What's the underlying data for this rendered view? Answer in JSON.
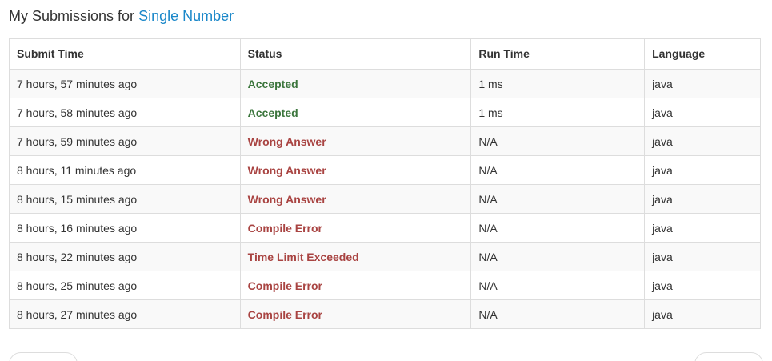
{
  "header": {
    "prefix": "My Submissions for",
    "problem_name": "Single Number"
  },
  "table": {
    "columns": [
      "Submit Time",
      "Status",
      "Run Time",
      "Language"
    ],
    "rows": [
      {
        "time": "7 hours, 57 minutes ago",
        "status": "Accepted",
        "status_type": "ok",
        "runtime": "1 ms",
        "language": "java"
      },
      {
        "time": "7 hours, 58 minutes ago",
        "status": "Accepted",
        "status_type": "ok",
        "runtime": "1 ms",
        "language": "java"
      },
      {
        "time": "7 hours, 59 minutes ago",
        "status": "Wrong Answer",
        "status_type": "bad",
        "runtime": "N/A",
        "language": "java"
      },
      {
        "time": "8 hours, 11 minutes ago",
        "status": "Wrong Answer",
        "status_type": "bad",
        "runtime": "N/A",
        "language": "java"
      },
      {
        "time": "8 hours, 15 minutes ago",
        "status": "Wrong Answer",
        "status_type": "bad",
        "runtime": "N/A",
        "language": "java"
      },
      {
        "time": "8 hours, 16 minutes ago",
        "status": "Compile Error",
        "status_type": "bad",
        "runtime": "N/A",
        "language": "java"
      },
      {
        "time": "8 hours, 22 minutes ago",
        "status": "Time Limit Exceeded",
        "status_type": "bad",
        "runtime": "N/A",
        "language": "java"
      },
      {
        "time": "8 hours, 25 minutes ago",
        "status": "Compile Error",
        "status_type": "bad",
        "runtime": "N/A",
        "language": "java"
      },
      {
        "time": "8 hours, 27 minutes ago",
        "status": "Compile Error",
        "status_type": "bad",
        "runtime": "N/A",
        "language": "java"
      }
    ]
  },
  "colors": {
    "accepted": "#3c763d",
    "error": "#a94442",
    "link": "#1a87c9"
  }
}
